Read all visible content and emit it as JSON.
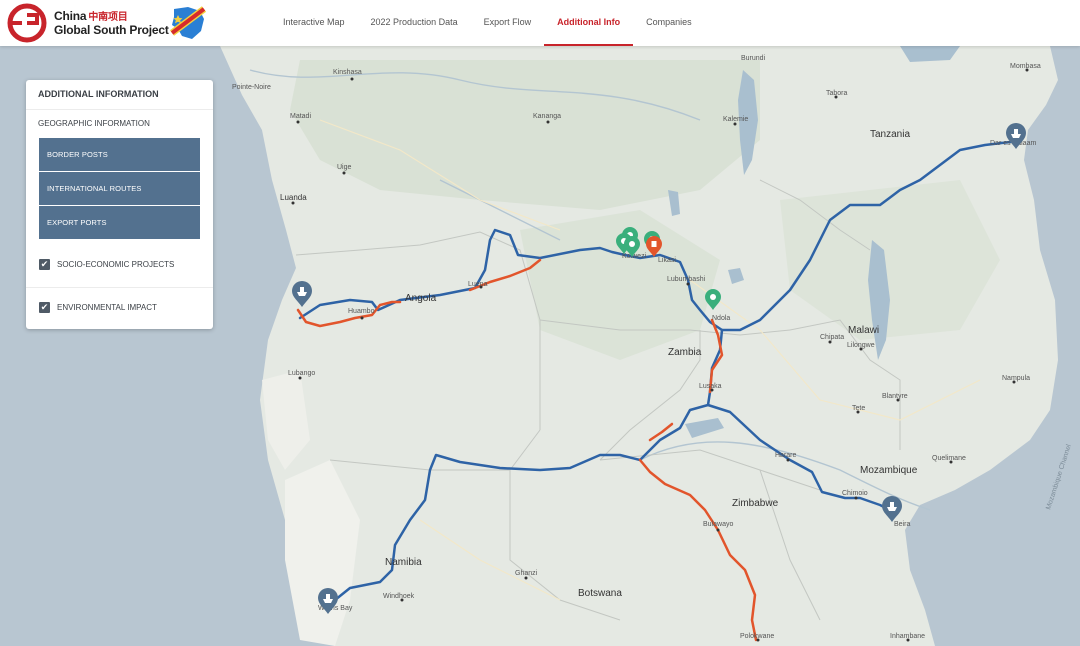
{
  "header": {
    "logo_line1": "China",
    "logo_zh": "中南项目",
    "logo_line2": "Global South Project",
    "nav": [
      "Interactive Map",
      "2022 Production Data",
      "Export Flow",
      "Additional Info",
      "Companies"
    ],
    "active_tab": "Additional Info"
  },
  "panel": {
    "title": "ADDITIONAL INFORMATION",
    "subtitle": "GEOGRAPHIC INFORMATION",
    "buttons": [
      "BORDER POSTS",
      "INTERNATIONAL ROUTES",
      "EXPORT PORTS"
    ],
    "checks": [
      {
        "label": "SOCIO-ECONOMIC PROJECTS",
        "checked": true
      },
      {
        "label": "ENVIRONMENTAL IMPACT",
        "checked": true
      }
    ]
  },
  "map": {
    "countries": [
      "Tanzania",
      "Angola",
      "Malawi",
      "Zambia",
      "Mozambique",
      "Zimbabwe",
      "Namibia",
      "Botswana"
    ],
    "cities": [
      "Kinshasa",
      "Pointe-Noire",
      "Matadi",
      "Kananga",
      "Burundi",
      "Mombasa",
      "Tabora",
      "Kalemie",
      "Luanda",
      "Uige",
      "Kolwezi",
      "Likasi",
      "Lubumbashi",
      "Ndola",
      "Huambo",
      "Luena",
      "Chipata",
      "Lilongwe",
      "Lusaka",
      "Lubango",
      "Tete",
      "Blantyre",
      "Nampula",
      "Harare",
      "Quelimane",
      "Chimoio",
      "Beira",
      "Bulawayo",
      "Ghanzi",
      "Windhoek",
      "Walvis Bay",
      "Dar es Salaam",
      "Polokwane",
      "Inhambane",
      "Mozambique Channel"
    ],
    "route_color": "#2e63a6",
    "impact_color": "#e2552c",
    "water_color": "#b8c6d1"
  }
}
